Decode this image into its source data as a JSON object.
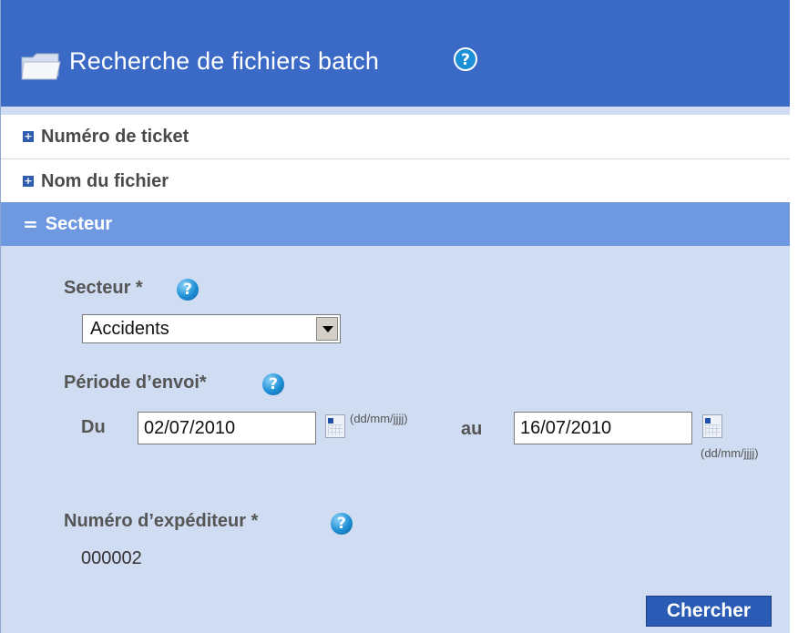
{
  "header": {
    "title": "Recherche de fichiers batch",
    "help_icon": "help-icon"
  },
  "sections": [
    {
      "toggle": "+",
      "label": "Numéro de ticket"
    },
    {
      "toggle": "+",
      "label": "Nom du fichier"
    },
    {
      "toggle": "=",
      "label": "Secteur"
    }
  ],
  "form": {
    "secteur_label": "Secteur *",
    "secteur_value": "Accidents",
    "periode_label": "Période d’envoi*",
    "du_label": "Du",
    "du_value": "02/07/2010",
    "du_hint": "(dd/mm/jjjj)",
    "au_label": "au",
    "au_value": "16/07/2010",
    "au_hint": "(dd/mm/jjjj)",
    "expediteur_label": "Numéro d’expéditeur *",
    "expediteur_value": "000002",
    "search_button": "Chercher"
  },
  "colors": {
    "header": "#3a69c6",
    "panel": "#cfdcf1",
    "active_section": "#6e98df",
    "button": "#2a5bb5"
  }
}
